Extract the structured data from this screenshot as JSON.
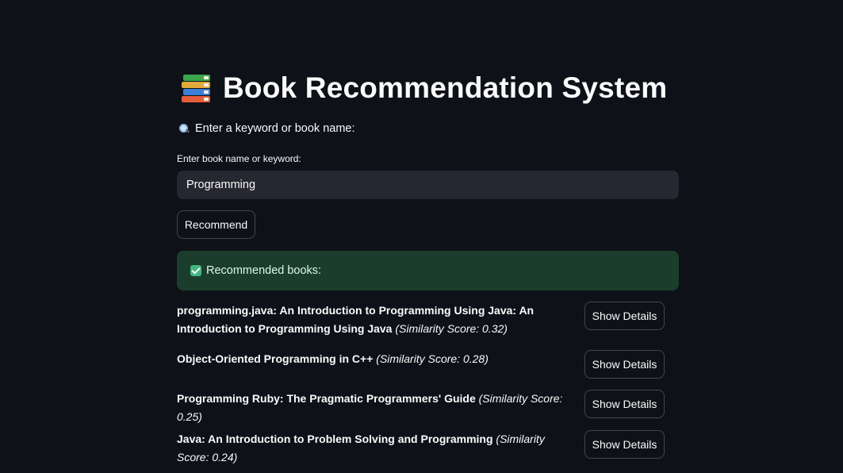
{
  "header": {
    "title": "Book Recommendation System",
    "icon": "books-icon"
  },
  "search": {
    "prompt": "Enter a keyword or book name:",
    "label": "Enter book name or keyword:",
    "value": "Programming",
    "button_label": "Recommend"
  },
  "status": {
    "message": "Recommended books:",
    "color": "#1b3e2c"
  },
  "results": [
    {
      "title": "programming.java: An Introduction to Programming Using Java: An Introduction to Programming Using Java",
      "score": "(Similarity Score: 0.32)",
      "button_label": "Show Details"
    },
    {
      "title": "Object-Oriented Programming in C++",
      "score": "(Similarity Score: 0.28)",
      "button_label": "Show Details"
    },
    {
      "title": "Programming Ruby: The Pragmatic Programmers' Guide",
      "score": "(Similarity Score: 0.25)",
      "button_label": "Show Details"
    },
    {
      "title": "Java: An Introduction to Problem Solving and Programming",
      "score": "(Similarity Score: 0.24)",
      "button_label": "Show Details"
    }
  ]
}
